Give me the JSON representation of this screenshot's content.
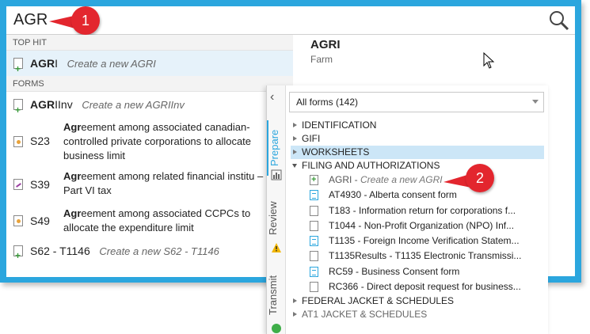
{
  "search": {
    "value": "AGR"
  },
  "callouts": [
    "1",
    "2"
  ],
  "left": {
    "top_hit_header": "TOP HIT",
    "top_hit": {
      "code_bold": "AGR",
      "code_rest": "I",
      "hint": "Create a new AGRI"
    },
    "forms_header": "FORMS",
    "forms": [
      {
        "code_bold": "AGR",
        "code_rest": "IInv",
        "hint": "Create a new AGRIInv"
      },
      {
        "code": "S23",
        "desc_bold": "Agr",
        "desc_rest": "eement among associated canadian-controlled private corporations to allocate business limit"
      },
      {
        "code": "S39",
        "desc_bold": "Agr",
        "desc_rest": "eement among related financial institu – Part VI tax"
      },
      {
        "code": "S49",
        "desc_bold": "Agr",
        "desc_rest": "eement among associated CCPCs to allocate the expenditure limit"
      },
      {
        "code": "S62 - T1146",
        "hint": "Create a new S62 - T1146"
      }
    ]
  },
  "detail": {
    "title": "AGRI",
    "subtitle": "Farm"
  },
  "panel": {
    "tabs": [
      "Prepare",
      "Review",
      "Transmit"
    ],
    "filter": "All forms (142)",
    "tree": [
      {
        "label": "IDENTIFICATION",
        "expanded": false
      },
      {
        "label": "GIFI",
        "expanded": false
      },
      {
        "label": "WORKSHEETS",
        "expanded": false,
        "selected": true
      },
      {
        "label": "FILING AND AUTHORIZATIONS",
        "expanded": true
      }
    ],
    "children": [
      {
        "code": "AGRI - ",
        "hint": "Create a new AGRI",
        "icon": "plus"
      },
      {
        "text": "AT4930 - Alberta consent form",
        "icon": "lines"
      },
      {
        "text": "T183 - Information return for corporations f...",
        "icon": "blank"
      },
      {
        "text": "T1044 - Non-Profit Organization (NPO) Inf...",
        "icon": "blank"
      },
      {
        "text": "T1135 - Foreign Income Verification Statem...",
        "icon": "lines"
      },
      {
        "text": "T1135Results - T1135 Electronic Transmissi...",
        "icon": "blank"
      },
      {
        "text": "RC59 - Business Consent form",
        "icon": "lines"
      },
      {
        "text": "RC366 - Direct deposit request for business...",
        "icon": "blank"
      }
    ],
    "tree_after": [
      {
        "label": "FEDERAL JACKET & SCHEDULES"
      },
      {
        "label": "AT1 JACKET & SCHEDULES"
      }
    ]
  },
  "colors": {
    "accent": "#2ba6de",
    "callout": "#e3262e",
    "selection": "#cce6f7"
  }
}
